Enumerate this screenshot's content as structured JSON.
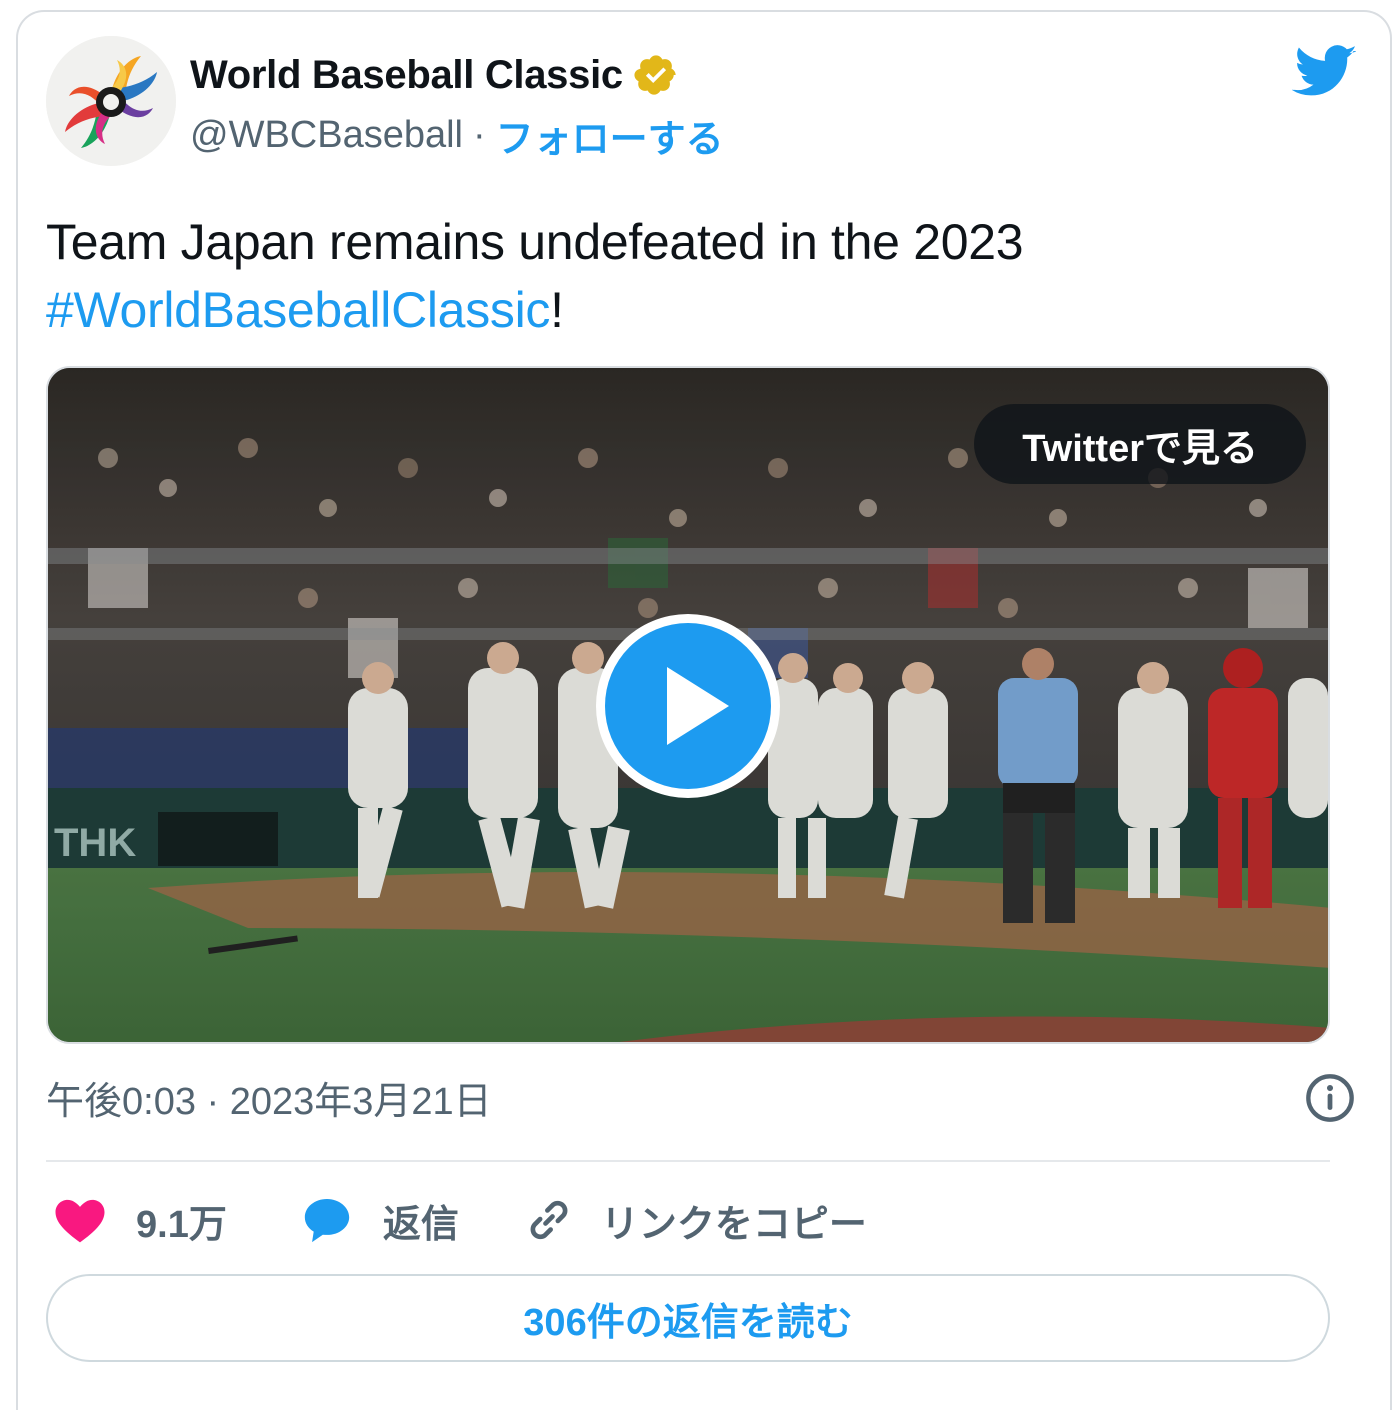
{
  "author": {
    "display_name": "World Baseball Classic",
    "handle": "@WBCBaseball",
    "separator": "·",
    "follow_label": "フォローする",
    "verified_badge_color": "#e2b719"
  },
  "tweet": {
    "text_line1": "Team Japan remains undefeated in the 2023",
    "hashtag": "#WorldBaseballClassic",
    "text_end": "!",
    "timestamp": "午後0:03 · 2023年3月21日"
  },
  "media": {
    "watch_label": "Twitterで見る",
    "play_icon": "play-icon",
    "scoreboard_text": "THK"
  },
  "actions": {
    "like_count": "9.1万",
    "reply_label": "返信",
    "copy_link_label": "リンクをコピー"
  },
  "read_replies_label": "306件の返信を読む",
  "colors": {
    "accent": "#1d9bf0",
    "like": "#f91880",
    "secondary_text": "#536471"
  }
}
